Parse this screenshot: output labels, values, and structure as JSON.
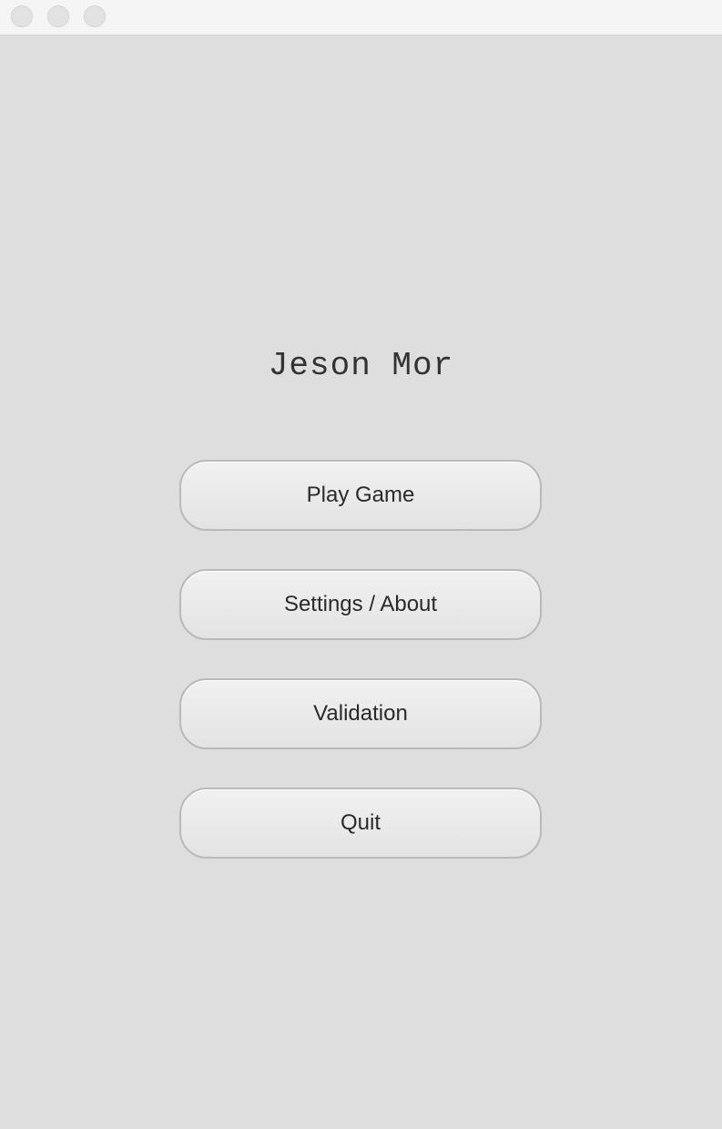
{
  "window": {
    "controls": [
      "close-icon",
      "minimize-icon",
      "zoom-icon"
    ]
  },
  "menu": {
    "title": "Jeson Mor",
    "buttons": {
      "play": "Play Game",
      "settings": "Settings / About",
      "validation": "Validation",
      "quit": "Quit"
    }
  },
  "colors": {
    "background": "#dedede",
    "titlebar": "#f5f5f5",
    "button_border": "#b9b9b9",
    "text": "#2a2a2a"
  }
}
